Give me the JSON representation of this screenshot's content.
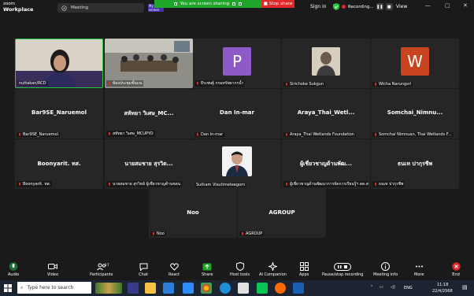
{
  "app": {
    "brand_line1": "zoom",
    "brand_line2": "Workplace"
  },
  "titlebar": {
    "meeting_label": "Meeting",
    "mini_screen_label": "My screen",
    "sharing_text": "You are screen sharing",
    "stop_share": "Stop share",
    "sign_in": "Sign in",
    "recording": "Recording...",
    "view": "View"
  },
  "tiles": [
    {
      "label": "nuttakan/RCD"
    },
    {
      "label": "ห้องประชุมชั้นบน"
    },
    {
      "initial": "P",
      "label": "ธีรเชษฐ์ กรมทรัพยากรน้ำ"
    },
    {
      "label": "Sirichoke Sukgun"
    },
    {
      "initial": "W",
      "label": "Wicha Narungsri"
    },
    {
      "center": "Bar9SE_Naruemol",
      "label": "Bar9SE_Naruemol"
    },
    {
      "center": "สหัทยา วิเศษ_MC...",
      "label": "สหัทยา วิเศษ_MCUPYO"
    },
    {
      "center": "Dan In-mar",
      "label": "Dan In-mar"
    },
    {
      "center": "Araya_Thai_Wetl...",
      "label": "Araya_Thai Wetlands Foundation"
    },
    {
      "center": "Somchai_Nimnu...",
      "label": "Somchai Nimnuan, Thai Wetlands F..."
    },
    {
      "center": "Boonyarit. ทส.",
      "label": "Boonyarit. ทส."
    },
    {
      "center": "นายสมชาย สุรวิต...",
      "label": "นายสมชาย สุรวิทย์ ผู้เชี่ยวชาญด้านชลน"
    },
    {
      "label": "Sutham Visutimeteegorn"
    },
    {
      "center": "ผู้เชี่ยวชาญด้านพัฒ...",
      "label": "ผู้เชี่ยวชาญด้านพัฒนาการจัดการเรียนรู้ฯ สค.สรร..."
    },
    {
      "center": "ธนเท ปากุรชีพ",
      "label": "ธนเท ปากุรชีพ"
    },
    {
      "center": "Noo",
      "label": "Noo"
    },
    {
      "center": "AGROUP",
      "label": "AGROUP"
    }
  ],
  "toolbar": {
    "audio": "Audio",
    "video": "Video",
    "participants": "Participants",
    "participants_count": "17",
    "chat": "Chat",
    "react": "React",
    "share": "Share",
    "host_tools": "Host tools",
    "ai_companion": "AI Companion",
    "apps": "Apps",
    "pause_recording": "Pause/stop recording",
    "meeting_info": "Meeting info",
    "more": "More",
    "end": "End"
  },
  "taskbar": {
    "search_placeholder": "Type here to search",
    "language": "ENG",
    "time": "11:18",
    "date": "22/4/2568"
  },
  "colors": {
    "sharing_green": "#1fa52a",
    "stop_red": "#e02828",
    "active_speaker": "#27c93f",
    "tile_bg": "#262626",
    "avatar_p": "#8e5ac8",
    "avatar_w": "#c8441f"
  }
}
